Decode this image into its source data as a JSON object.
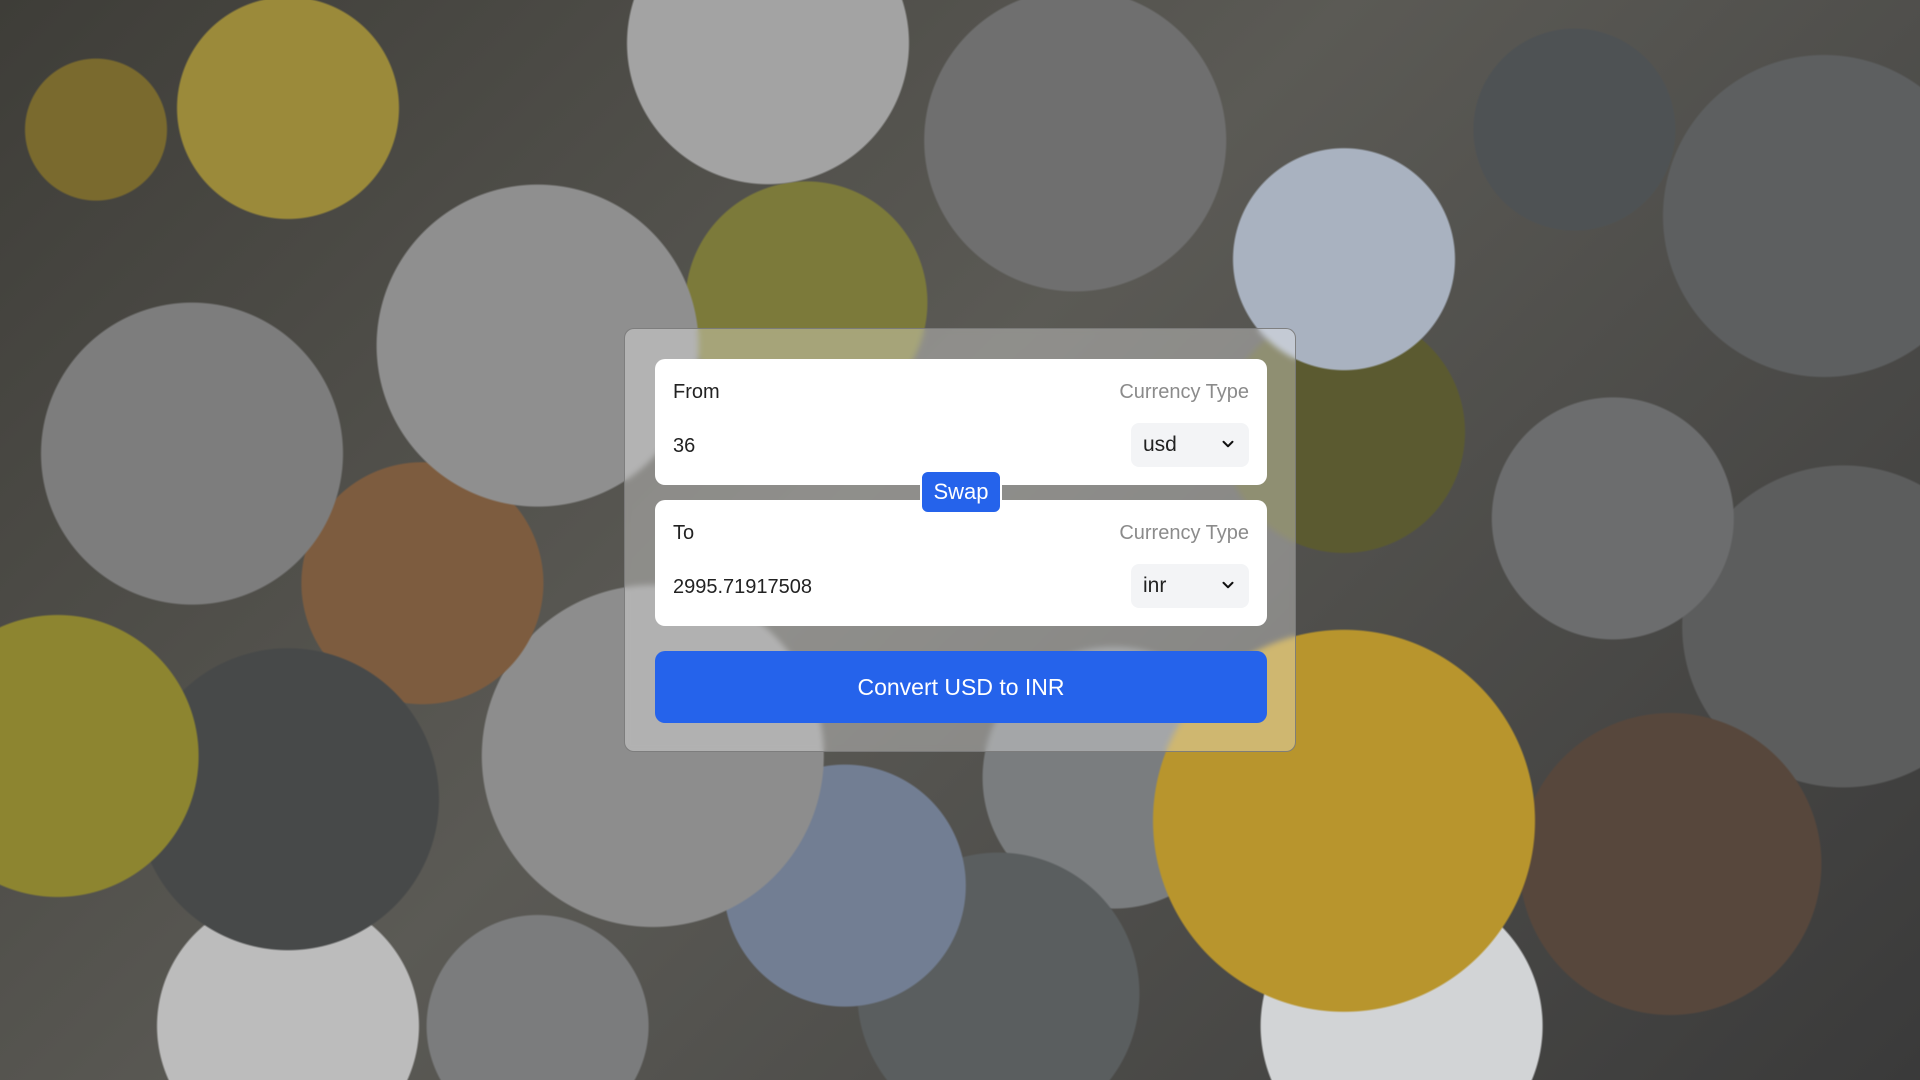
{
  "from": {
    "label": "From",
    "type_label": "Currency Type",
    "amount": "36",
    "currency": "usd"
  },
  "swap_label": "Swap",
  "to": {
    "label": "To",
    "type_label": "Currency Type",
    "amount": "2995.71917508",
    "currency": "inr"
  },
  "convert_label": "Convert USD to INR",
  "colors": {
    "accent": "#2563eb",
    "card_bg": "#ffffff",
    "muted_text": "#8b8b8b"
  },
  "icons": {
    "select_arrow": "chevron-down-icon",
    "background": "coins-photo"
  }
}
